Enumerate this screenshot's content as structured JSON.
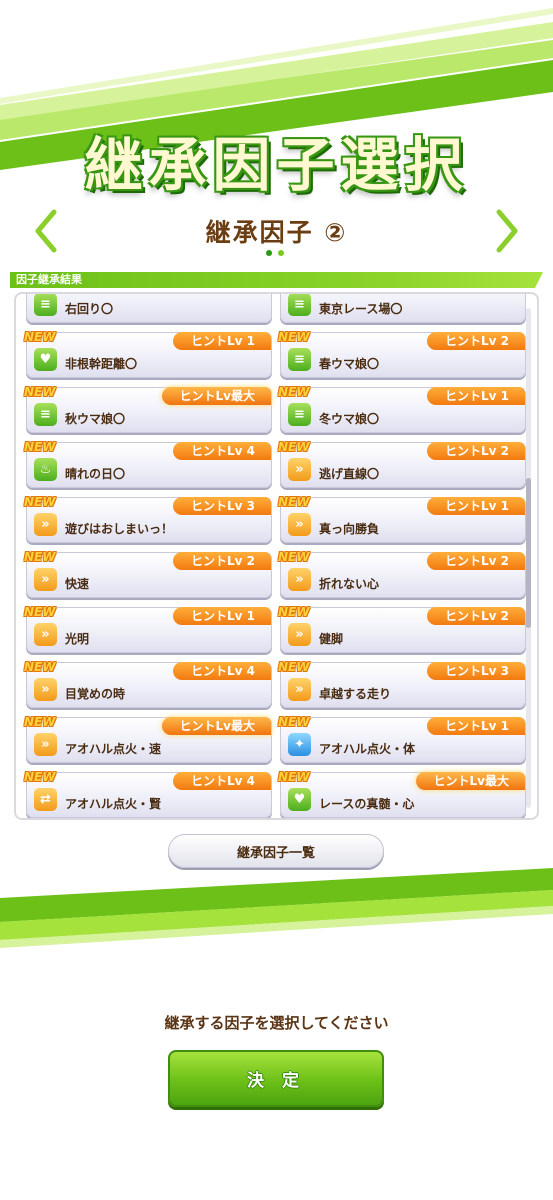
{
  "header": {
    "title": "継承因子選択",
    "subtitle": "継承因子 ②",
    "page_indicator": {
      "current": 2,
      "total": 2
    }
  },
  "section": {
    "label": "因子継承結果"
  },
  "factors": [
    {
      "label": "右回り〇",
      "hint": "",
      "new": false,
      "icon": "course-icon",
      "color": "green"
    },
    {
      "label": "東京レース場〇",
      "hint": "",
      "new": false,
      "icon": "course-icon",
      "color": "green"
    },
    {
      "label": "非根幹距離〇",
      "hint": "ヒントLv 1",
      "new": true,
      "icon": "heart-icon",
      "color": "green"
    },
    {
      "label": "春ウマ娘〇",
      "hint": "ヒントLv 2",
      "new": true,
      "icon": "course-icon",
      "color": "green"
    },
    {
      "label": "秋ウマ娘〇",
      "hint": "ヒントLv最大",
      "new": true,
      "icon": "course-icon",
      "color": "green"
    },
    {
      "label": "冬ウマ娘〇",
      "hint": "ヒントLv 1",
      "new": true,
      "icon": "course-icon",
      "color": "green"
    },
    {
      "label": "晴れの日〇",
      "hint": "ヒントLv 4",
      "new": true,
      "icon": "flame-icon",
      "color": "green"
    },
    {
      "label": "逃げ直線〇",
      "hint": "ヒントLv 2",
      "new": true,
      "icon": "runner-icon",
      "color": "orange"
    },
    {
      "label": "遊びはおしまいっ！",
      "hint": "ヒントLv 3",
      "new": true,
      "icon": "runner-icon",
      "color": "orange"
    },
    {
      "label": "真っ向勝負",
      "hint": "ヒントLv 1",
      "new": true,
      "icon": "runner-icon",
      "color": "orange"
    },
    {
      "label": "快速",
      "hint": "ヒントLv 2",
      "new": true,
      "icon": "runner-icon",
      "color": "orange"
    },
    {
      "label": "折れない心",
      "hint": "ヒントLv 2",
      "new": true,
      "icon": "runner-icon",
      "color": "orange"
    },
    {
      "label": "光明",
      "hint": "ヒントLv 1",
      "new": true,
      "icon": "runner-icon",
      "color": "orange"
    },
    {
      "label": "健脚",
      "hint": "ヒントLv 2",
      "new": true,
      "icon": "runner-icon",
      "color": "orange"
    },
    {
      "label": "目覚めの時",
      "hint": "ヒントLv 4",
      "new": true,
      "icon": "runner-icon",
      "color": "orange"
    },
    {
      "label": "卓越する走り",
      "hint": "ヒントLv 3",
      "new": true,
      "icon": "runner-icon",
      "color": "orange"
    },
    {
      "label": "アオハル点火・速",
      "hint": "ヒントLv最大",
      "new": true,
      "icon": "runner-icon",
      "color": "orange"
    },
    {
      "label": "アオハル点火・体",
      "hint": "ヒントLv 1",
      "new": true,
      "icon": "sparkle-icon",
      "color": "blue"
    },
    {
      "label": "アオハル点火・賢",
      "hint": "ヒントLv 4",
      "new": true,
      "icon": "swap-icon",
      "color": "orange"
    },
    {
      "label": "レースの真髄・心",
      "hint": "ヒントLv最大",
      "new": true,
      "icon": "heart-icon",
      "color": "green"
    }
  ],
  "new_badge": "NEW",
  "buttons": {
    "factor_list": "継承因子一覧",
    "decide": "決 定"
  },
  "instruction": "継承する因子を選択してください",
  "colors": {
    "accent_green": "#6cc018",
    "hint_orange": "#f27a10",
    "text_brown": "#4a2c12"
  }
}
